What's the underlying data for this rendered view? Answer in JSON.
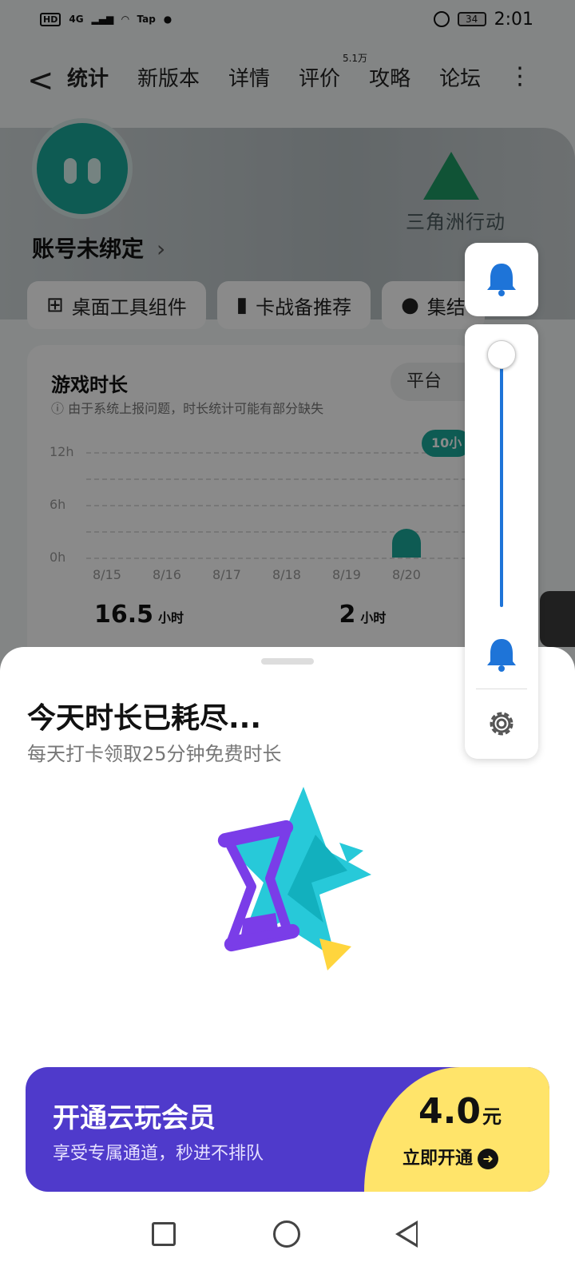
{
  "status_bar": {
    "left_labels": [
      "HD",
      "4G",
      "Tap"
    ],
    "battery": "34",
    "time": "2:01"
  },
  "nav": {
    "back_symbol": "<",
    "tabs": [
      {
        "label": "统计"
      },
      {
        "label": "新版本"
      },
      {
        "label": "详情"
      },
      {
        "label": "评价",
        "badge": "5.1万"
      },
      {
        "label": "攻略"
      },
      {
        "label": "论坛"
      }
    ],
    "more_symbol": "⋮"
  },
  "banner": {
    "logo_text": "三角洲行动"
  },
  "account": {
    "label": "账号未绑定",
    "chevron": "›"
  },
  "chips": [
    {
      "label": "桌面工具组件",
      "icon": "grid-icon"
    },
    {
      "label": "卡战备推荐",
      "icon": "book-icon"
    },
    {
      "label": "集结",
      "icon": "person-icon"
    }
  ],
  "play_card": {
    "title": "游戏时长",
    "note": "由于系统上报问题，时长统计可能有部分缺失",
    "platform_label": "平台",
    "highlight_pill": "10小",
    "stats": [
      {
        "value": "16.5",
        "unit": "小时"
      },
      {
        "value": "2",
        "unit": "小时"
      }
    ]
  },
  "chart_data": {
    "type": "bar",
    "categories": [
      "8/15",
      "8/16",
      "8/17",
      "8/18",
      "8/19",
      "8/20"
    ],
    "values": [
      0,
      0,
      0,
      0,
      0,
      2
    ],
    "yticks": [
      "12h",
      "6h",
      "0h"
    ],
    "ylim": [
      0,
      12
    ],
    "xlabel": "",
    "ylabel": "",
    "color": "#1aa99a"
  },
  "sheet": {
    "title": "今天时长已耗尽...",
    "subtitle": "每天打卡领取25分钟免费时长"
  },
  "vip": {
    "title": "开通云玩会员",
    "subtitle": "享受专属通道，秒进不排队",
    "price": "4.0",
    "price_unit": "元",
    "button": "立即开通",
    "colors": {
      "primary": "#4f3acb",
      "accent": "#ffe46a"
    }
  },
  "volume_widget": {
    "level_fraction": 1.0,
    "icons": [
      "bell-icon",
      "bell-icon",
      "gear-icon"
    ],
    "accent": "#1e74d8"
  },
  "system_nav": [
    "recents-icon",
    "home-icon",
    "back-icon"
  ]
}
